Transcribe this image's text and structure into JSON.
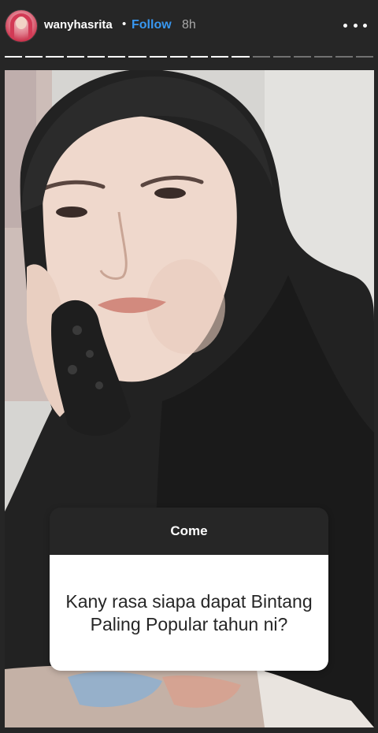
{
  "header": {
    "username": "wanyhasrita",
    "separator": "•",
    "follow_label": "Follow",
    "time": "8h",
    "avatar_icon": "profile-avatar",
    "more_icon": "more-dots-icon"
  },
  "progress": {
    "total_segments": 18,
    "completed_segments": 12
  },
  "question": {
    "prompt": "Come",
    "text": "Kany rasa siapa dapat Bintang Paling Popular tahun ni?"
  },
  "colors": {
    "background": "#262626",
    "follow": "#3897f0",
    "sticker_header": "#262626",
    "sticker_body": "#ffffff"
  }
}
